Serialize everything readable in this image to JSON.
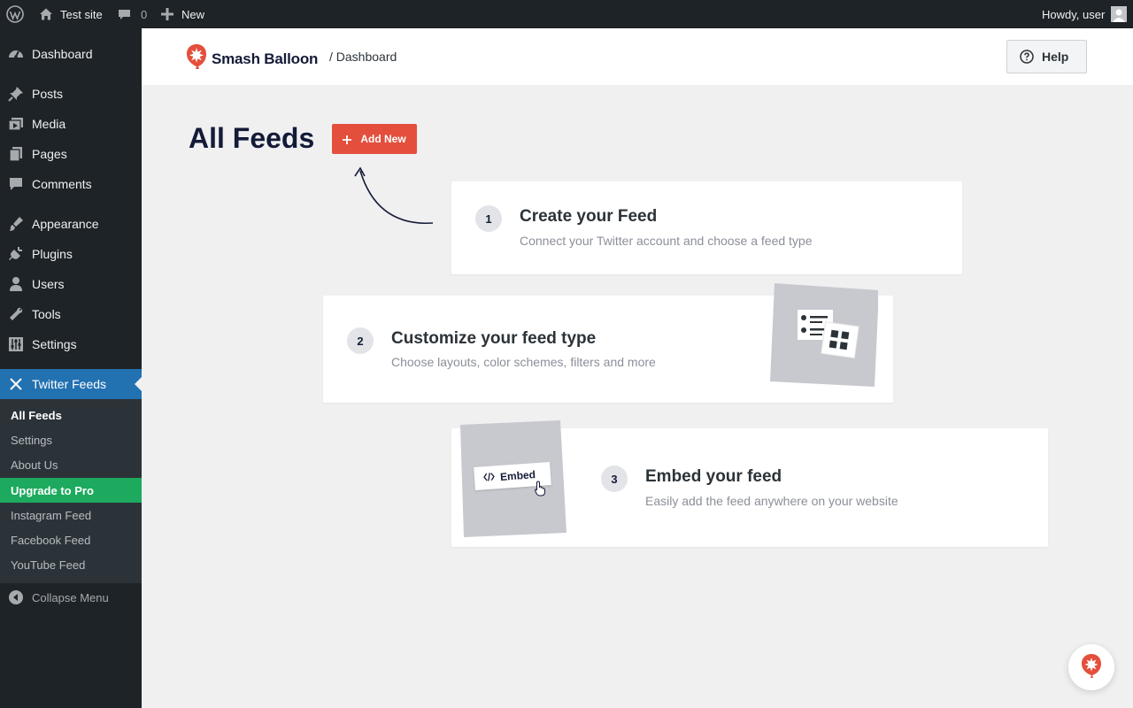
{
  "admin_bar": {
    "site_name": "Test site",
    "comments_count": "0",
    "new_label": "New",
    "greeting": "Howdy, user"
  },
  "sidebar": {
    "items": [
      {
        "label": "Dashboard",
        "icon": "dashboard-icon"
      },
      {
        "label": "Posts",
        "icon": "pin-icon"
      },
      {
        "label": "Media",
        "icon": "media-icon"
      },
      {
        "label": "Pages",
        "icon": "pages-icon"
      },
      {
        "label": "Comments",
        "icon": "comment-icon"
      },
      {
        "label": "Appearance",
        "icon": "brush-icon"
      },
      {
        "label": "Plugins",
        "icon": "plug-icon"
      },
      {
        "label": "Users",
        "icon": "user-icon"
      },
      {
        "label": "Tools",
        "icon": "wrench-icon"
      },
      {
        "label": "Settings",
        "icon": "sliders-icon"
      },
      {
        "label": "Twitter Feeds",
        "icon": "x-icon"
      }
    ],
    "submenu": [
      {
        "label": "All Feeds"
      },
      {
        "label": "Settings"
      },
      {
        "label": "About Us"
      },
      {
        "label": "Upgrade to Pro"
      },
      {
        "label": "Instagram Feed"
      },
      {
        "label": "Facebook Feed"
      },
      {
        "label": "YouTube Feed"
      }
    ],
    "collapse_label": "Collapse Menu"
  },
  "header": {
    "brand": "Smash Balloon",
    "breadcrumb": "/ Dashboard",
    "help_label": "Help"
  },
  "main": {
    "title": "All Feeds",
    "add_new_label": "Add New",
    "steps": [
      {
        "number": "1",
        "title": "Create your Feed",
        "description": "Connect your Twitter account and choose a feed type"
      },
      {
        "number": "2",
        "title": "Customize your feed type",
        "description": "Choose layouts, color schemes, filters and more"
      },
      {
        "number": "3",
        "title": "Embed your feed",
        "description": "Easily add the feed anywhere on your website"
      }
    ],
    "embed_illustration_label": "Embed"
  },
  "colors": {
    "admin_dark": "#1d2327",
    "wp_blue": "#2271b1",
    "upgrade_green": "#1daa5e",
    "brand_red": "#e34f3c"
  }
}
